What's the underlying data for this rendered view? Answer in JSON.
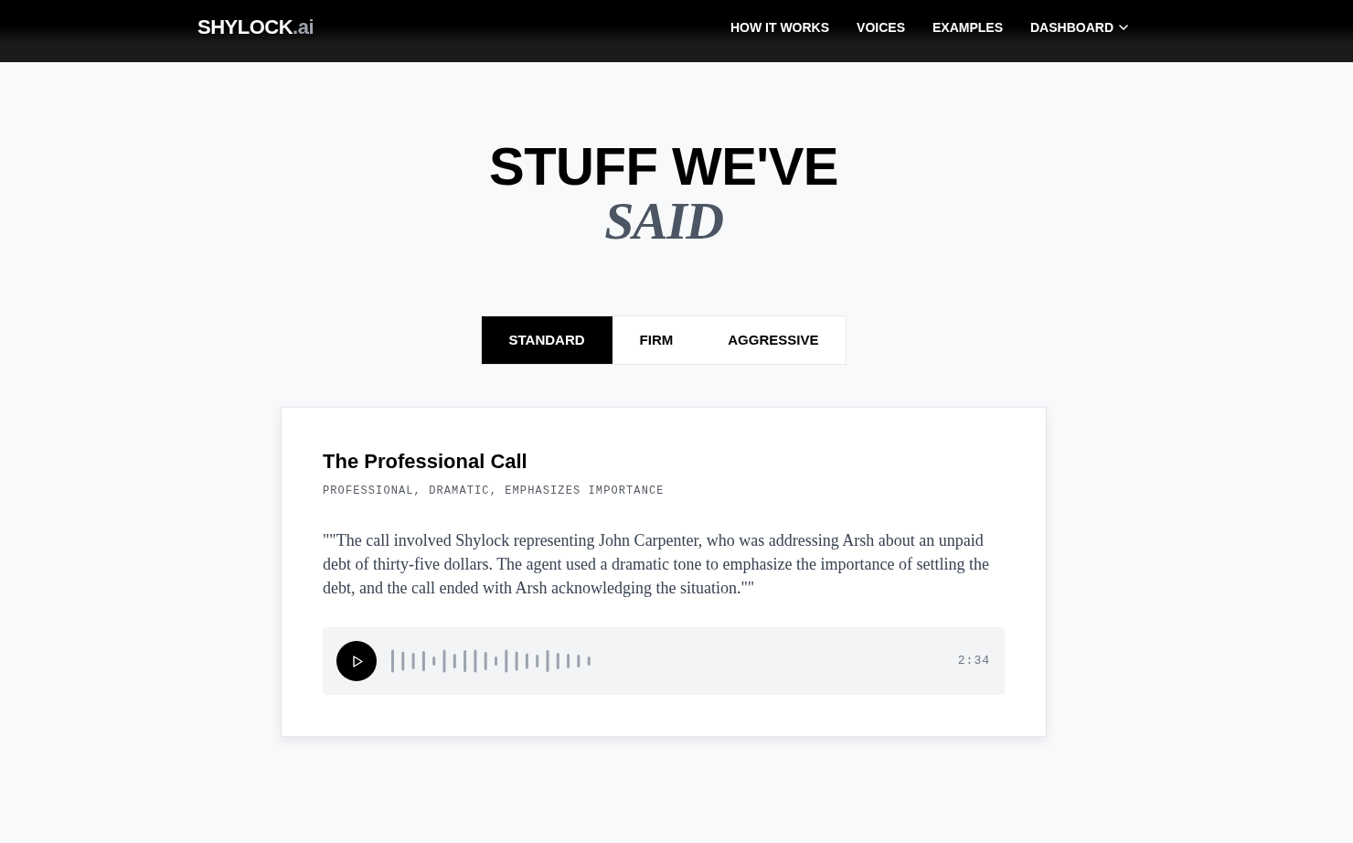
{
  "header": {
    "logo": {
      "name": "SHYLOCK",
      "suffix": ".ai"
    },
    "nav": [
      {
        "label": "HOW IT WORKS",
        "has_menu": false
      },
      {
        "label": "VOICES",
        "has_menu": false
      },
      {
        "label": "EXAMPLES",
        "has_menu": false
      },
      {
        "label": "DASHBOARD",
        "has_menu": true
      }
    ]
  },
  "hero": {
    "title": "STUFF WE'VE",
    "subtitle": "SAID"
  },
  "tabs": [
    {
      "label": "STANDARD",
      "selected": true
    },
    {
      "label": "FIRM",
      "selected": false
    },
    {
      "label": "AGGRESSIVE",
      "selected": false
    }
  ],
  "card": {
    "title": "The Professional Call",
    "tags": "PROFESSIONAL, DRAMATIC, EMPHASIZES IMPORTANCE",
    "quote": "\"\"The call involved Shylock representing John Carpenter, who was addressing Arsh about an unpaid debt of thirty-five dollars. The agent used a dramatic tone to emphasize the importance of settling the debt, and the call ended with Arsh acknowledging the situation.\"\"",
    "player": {
      "playing": false,
      "duration": "2:34"
    }
  }
}
